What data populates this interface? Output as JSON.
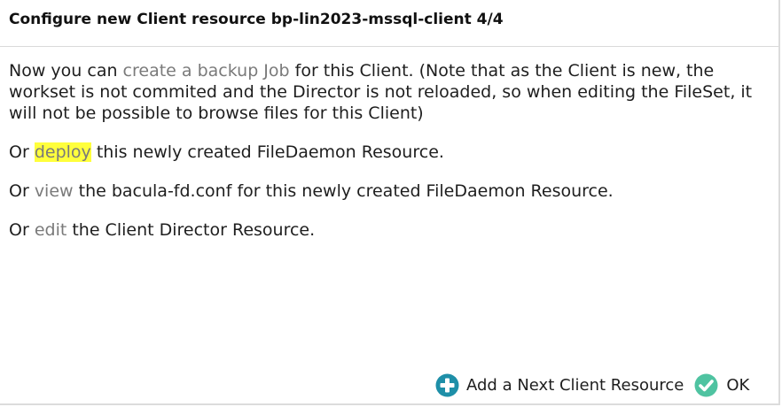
{
  "dialog": {
    "title": "Configure new Client resource bp-lin2023-mssql-client 4/4"
  },
  "body": {
    "p1": {
      "before": "Now you can ",
      "link": "create a backup Job",
      "after": " for this Client. (Note that as the Client is new, the workset is not commited and the Director is not reloaded, so when editing the FileSet, it will not be possible to browse files for this Client)"
    },
    "p2": {
      "before": "Or ",
      "link": "deploy",
      "after": " this newly created FileDaemon Resource."
    },
    "p3": {
      "before": "Or ",
      "link": "view",
      "after": " the bacula-fd.conf for this newly created FileDaemon Resource."
    },
    "p4": {
      "before": "Or ",
      "link": "edit",
      "after": " the Client Director Resource."
    }
  },
  "actions": {
    "add_next_label": "Add a Next Client Resource",
    "ok_label": "OK"
  },
  "colors": {
    "add_icon": "#1e8fa8",
    "ok_icon": "#4fc3a1",
    "highlight": "#ffff3c",
    "link": "#7a7a7a"
  },
  "icons": {
    "add_next": "plus-circle-icon",
    "ok": "check-circle-icon"
  }
}
